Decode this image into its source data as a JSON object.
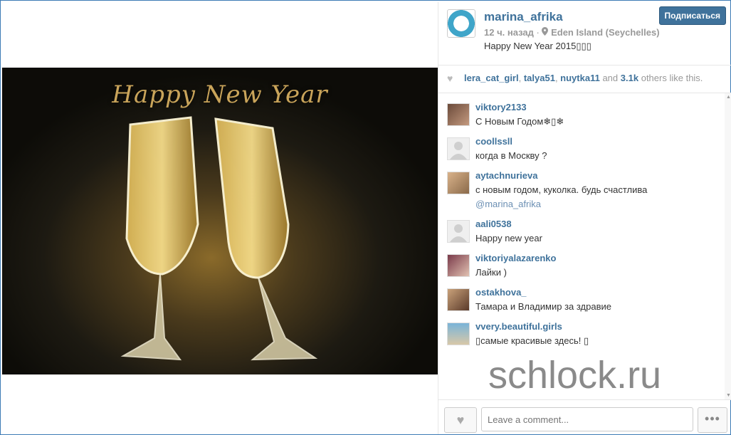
{
  "media": {
    "title_text": "Happy New Year"
  },
  "post": {
    "username": "marina_afrika",
    "follow_label": "Подписаться",
    "time": "12 ч. назад",
    "location": "Eden Island (Seychelles)",
    "caption": "Happy New Year 2015▯▯▯"
  },
  "likes": {
    "names": [
      "lera_cat_girl",
      "talya51",
      "nuytka11"
    ],
    "count": "3.1k",
    "suffix": "others like this.",
    "and_word": "and"
  },
  "comments": [
    {
      "user": "viktory2133",
      "text": "С Новым Годом❄▯❄"
    },
    {
      "user": "coollssll",
      "text": "когда в Москву ?"
    },
    {
      "user": "aytachnurieva",
      "text": "с новым годом, куколка. будь счастлива",
      "mention": "@marina_afrika"
    },
    {
      "user": "aali0538",
      "text": "Happy new year"
    },
    {
      "user": "viktoriyalazarenko",
      "text": "Лайки )"
    },
    {
      "user": "ostakhova_",
      "text": "Тамара и Владимир за здравие"
    },
    {
      "user": "vvery.beautiful.girls",
      "text": "▯самые красивые здесь! ▯"
    }
  ],
  "footer": {
    "comment_placeholder": "Leave a comment...",
    "more_label": "•••"
  },
  "watermark": "schlock.ru",
  "colors": {
    "brand_blue": "#3f729b",
    "link_blue": "#6b8fb3"
  },
  "icons": {
    "like": "heart-icon",
    "location": "map-pin-icon"
  }
}
